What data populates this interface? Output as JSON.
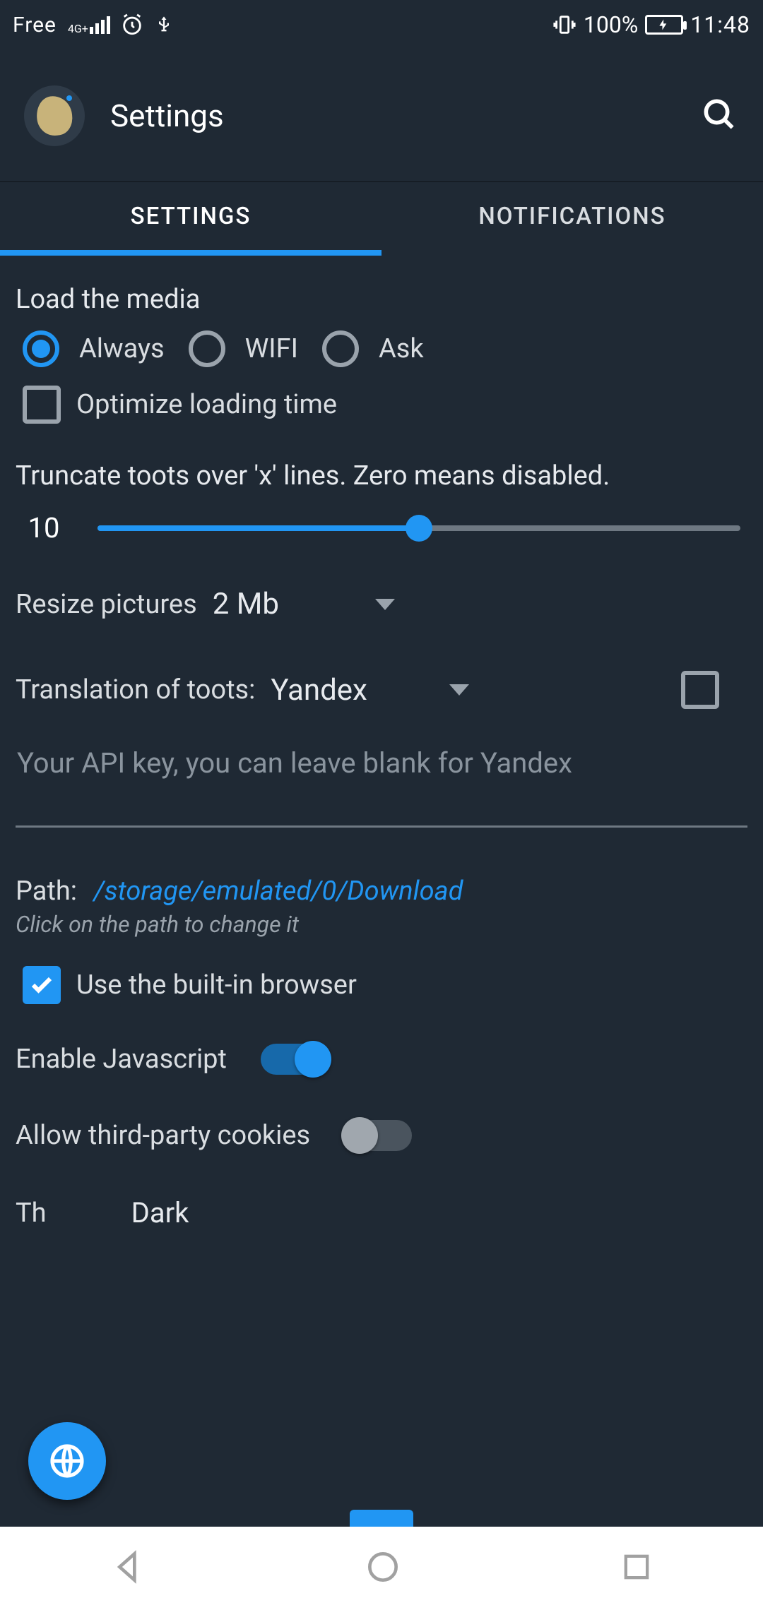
{
  "status": {
    "carrier": "Free",
    "net_tag": "4G+",
    "battery_pct": "100%",
    "time": "11:48"
  },
  "header": {
    "title": "Settings"
  },
  "tabs": {
    "settings": "SETTINGS",
    "notifications": "NOTIFICATIONS",
    "active": "settings"
  },
  "media": {
    "section_label": "Load the media",
    "options": {
      "always": "Always",
      "wifi": "WIFI",
      "ask": "Ask"
    },
    "selected": "always",
    "optimize_label": "Optimize loading time",
    "optimize_checked": false
  },
  "truncate": {
    "label": "Truncate toots over 'x' lines. Zero means disabled.",
    "value": "10",
    "min": 0,
    "max": 20,
    "current": 10
  },
  "resize": {
    "label": "Resize pictures",
    "value": "2 Mb"
  },
  "translation": {
    "label": "Translation of toots:",
    "value": "Yandex",
    "extra_checked": false,
    "api_key_placeholder": "Your API key, you can leave blank for Yandex",
    "api_key_value": ""
  },
  "path": {
    "label": "Path:",
    "value": "/storage/emulated/0/Download",
    "hint": "Click on the path to change it"
  },
  "browser": {
    "builtin_label": "Use the built-in browser",
    "builtin_checked": true,
    "js_label": "Enable Javascript",
    "js_on": true,
    "cookies_label": "Allow third-party cookies",
    "cookies_on": false
  },
  "theme": {
    "label_partial": "Th",
    "value": "Dark"
  }
}
